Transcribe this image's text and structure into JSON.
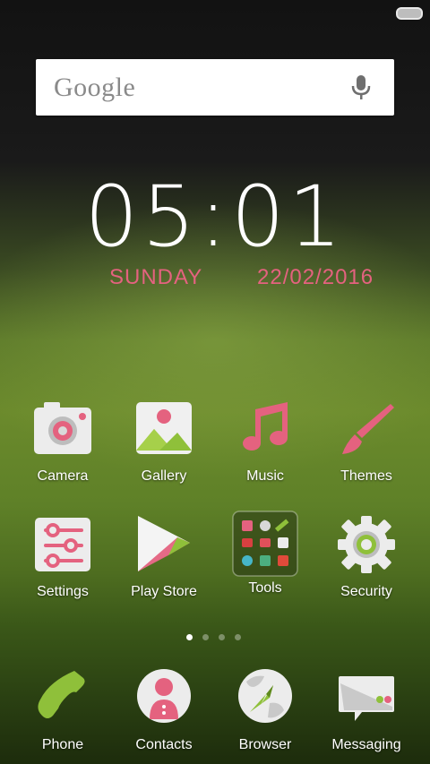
{
  "status_bar": {
    "battery_icon": "battery-icon"
  },
  "search": {
    "logo": "Google",
    "mic_icon": "mic-icon"
  },
  "clock": {
    "time": "05:01",
    "day": "SUNDAY",
    "date": "22/02/2016"
  },
  "colors": {
    "accent_pink": "#e4627f",
    "accent_green": "#8fc03a"
  },
  "apps_row1": [
    {
      "label": "Camera",
      "icon": "camera-icon"
    },
    {
      "label": "Gallery",
      "icon": "gallery-icon"
    },
    {
      "label": "Music",
      "icon": "music-note-icon"
    },
    {
      "label": "Themes",
      "icon": "paintbrush-icon"
    }
  ],
  "apps_row2": [
    {
      "label": "Settings",
      "icon": "sliders-icon"
    },
    {
      "label": "Play Store",
      "icon": "play-store-icon"
    },
    {
      "label": "Tools",
      "icon": "folder-icon"
    },
    {
      "label": "Security",
      "icon": "gear-icon"
    }
  ],
  "page_indicator": {
    "pages": 4,
    "current": 1
  },
  "dock": [
    {
      "label": "Phone",
      "icon": "phone-icon"
    },
    {
      "label": "Contacts",
      "icon": "contacts-icon"
    },
    {
      "label": "Browser",
      "icon": "globe-icon"
    },
    {
      "label": "Messaging",
      "icon": "message-icon"
    }
  ]
}
